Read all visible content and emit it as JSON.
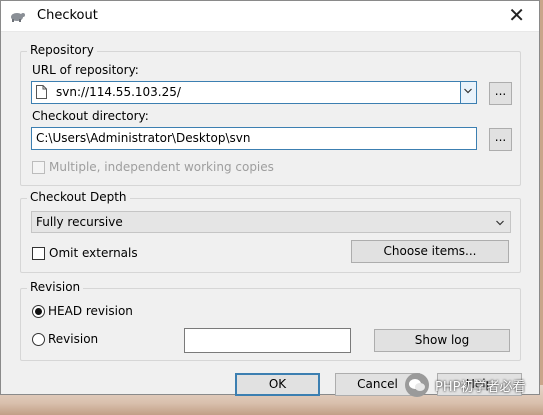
{
  "window": {
    "title": "Checkout",
    "close_glyph": "✕"
  },
  "repository": {
    "legend": "Repository",
    "url_label": "URL of repository:",
    "url_value": "svn://114.55.103.25/",
    "url_browse": "...",
    "dir_label": "Checkout directory:",
    "dir_value": "C:\\Users\\Administrator\\Desktop\\svn",
    "dir_browse": "...",
    "multi_label": "Multiple, independent working copies"
  },
  "depth": {
    "legend": "Checkout Depth",
    "selected": "Fully recursive",
    "omit_label": "Omit externals",
    "choose_items": "Choose items..."
  },
  "revision": {
    "legend": "Revision",
    "head_label": "HEAD revision",
    "rev_label": "Revision",
    "rev_value": "",
    "show_log": "Show log"
  },
  "buttons": {
    "ok": "OK",
    "cancel": "Cancel",
    "help": "Help"
  },
  "watermark": {
    "text": "PHP初学者必看"
  }
}
